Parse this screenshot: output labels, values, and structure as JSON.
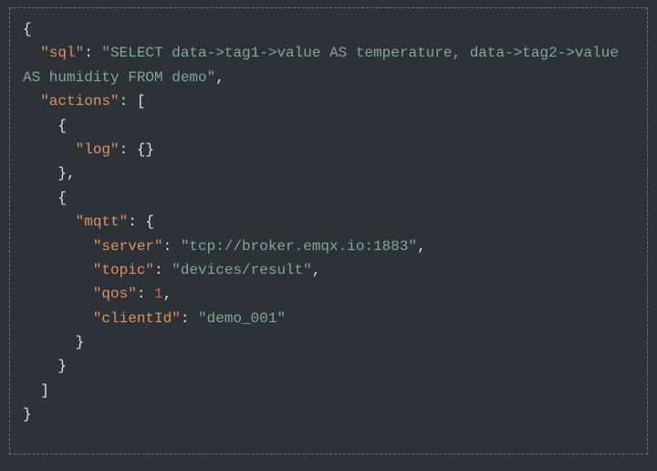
{
  "json_display": {
    "keys": {
      "sql": "\"sql\"",
      "actions": "\"actions\"",
      "log": "\"log\"",
      "mqtt": "\"mqtt\"",
      "server": "\"server\"",
      "topic": "\"topic\"",
      "qos": "\"qos\"",
      "clientId": "\"clientId\""
    },
    "values": {
      "sql": "\"SELECT data->tag1->value AS temperature, data->tag2->value AS humidity FROM demo\"",
      "server": "\"tcp://broker.emqx.io:1883\"",
      "topic": "\"devices/result\"",
      "qos": "1",
      "clientId": "\"demo_001\""
    },
    "punct": {
      "lbrace": "{",
      "rbrace": "}",
      "lbracket": "[",
      "rbracket": "]",
      "colon": ":",
      "comma": ",",
      "colon_space": ": ",
      "colon_lbrace": ": {",
      "colon_lbrace_rbrace": ": {}",
      "rbrace_comma": "},",
      "colon_lbracket": ": ["
    },
    "indent": {
      "i1": "  ",
      "i2": "    ",
      "i3": "      ",
      "i4": "        "
    }
  }
}
